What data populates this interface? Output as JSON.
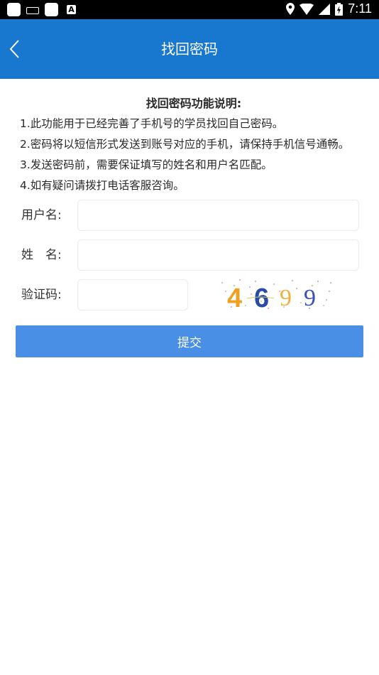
{
  "status_bar": {
    "time": "7:11",
    "icons": [
      "app-icon",
      "keyboard-icon",
      "app-icon",
      "text-a-icon",
      "location-icon",
      "wifi-icon",
      "signal-icon",
      "battery-icon"
    ]
  },
  "app_bar": {
    "title": "找回密码",
    "back_icon": "chevron-left-icon",
    "color": "#1878cf"
  },
  "instructions": {
    "title": "找回密码功能说明:",
    "lines": [
      "1.此功能用于已经完善了手机号的学员找回自己密码。",
      "2.密码将以短信形式发送到账号对应的手机，请保持手机信号通畅。",
      "3.发送密码前，需要保证填写的姓名和用户名匹配。",
      "4.如有疑问请拨打电话客服咨询。"
    ]
  },
  "form": {
    "username_label": "用户名:",
    "username_value": "",
    "name_label": "姓　名:",
    "name_value": "",
    "captcha_label": "验证码:",
    "captcha_value": "",
    "captcha_text": "4699"
  },
  "submit": {
    "label": "提交",
    "color": "#4a8fe6"
  }
}
